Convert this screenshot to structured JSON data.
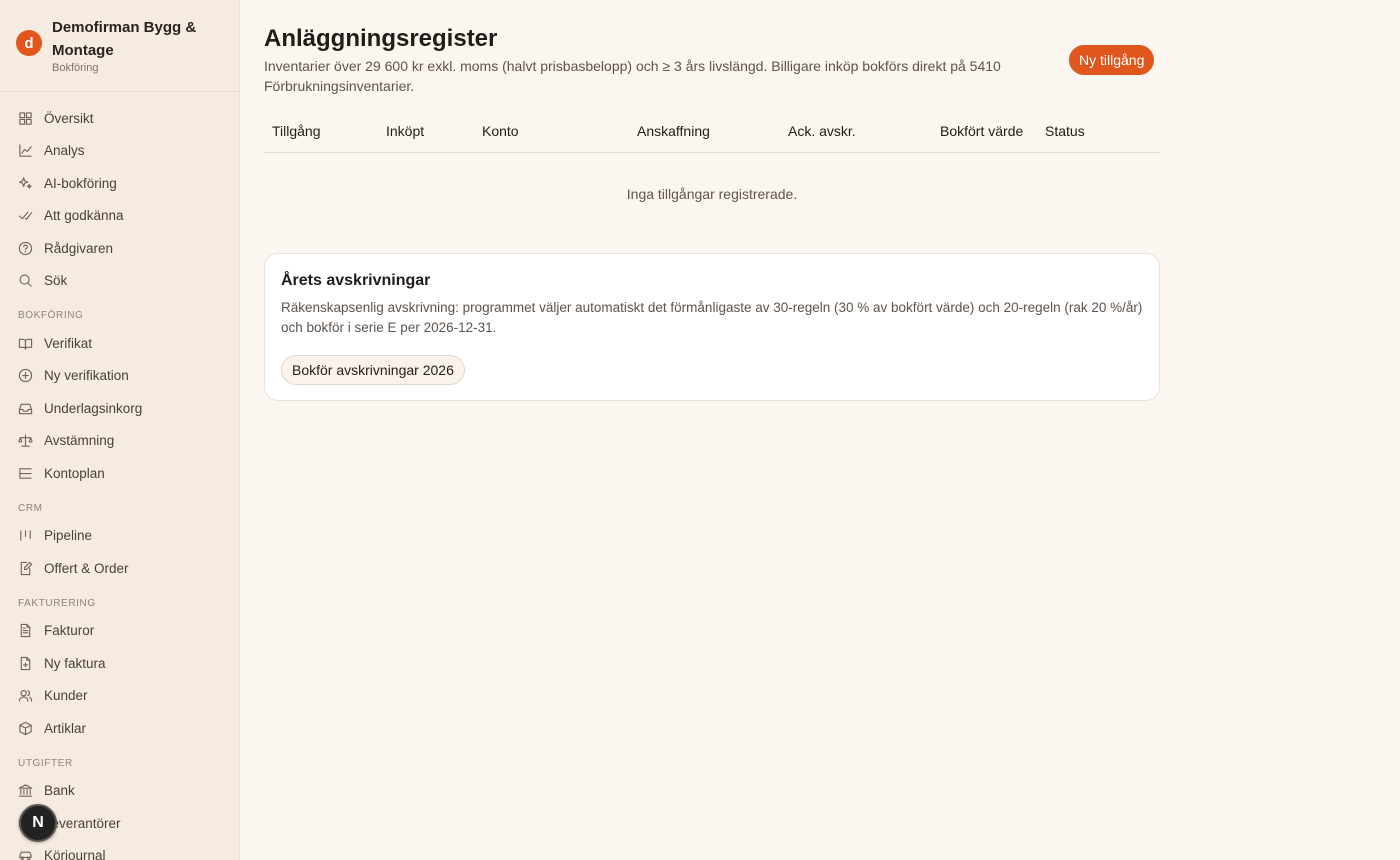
{
  "brand": {
    "logo_letter": "d",
    "name": "Demofirman Bygg & Montage",
    "subtitle": "Bokföring"
  },
  "nav": {
    "top": [
      {
        "label": "Översikt",
        "icon": "grid-icon"
      },
      {
        "label": "Analys",
        "icon": "chart-line-icon"
      },
      {
        "label": "AI-bokföring",
        "icon": "sparkles-icon"
      },
      {
        "label": "Att godkänna",
        "icon": "double-check-icon"
      },
      {
        "label": "Rådgivaren",
        "icon": "help-circle-icon"
      },
      {
        "label": "Sök",
        "icon": "search-icon"
      }
    ],
    "sections": [
      {
        "title": "BOKFÖRING",
        "items": [
          {
            "label": "Verifikat",
            "icon": "book-icon"
          },
          {
            "label": "Ny verifikation",
            "icon": "plus-circle-icon"
          },
          {
            "label": "Underlagsinkorg",
            "icon": "inbox-icon"
          },
          {
            "label": "Avstämning",
            "icon": "scale-icon"
          },
          {
            "label": "Kontoplan",
            "icon": "list-tree-icon"
          }
        ]
      },
      {
        "title": "CRM",
        "items": [
          {
            "label": "Pipeline",
            "icon": "kanban-icon"
          },
          {
            "label": "Offert & Order",
            "icon": "file-edit-icon"
          }
        ]
      },
      {
        "title": "FAKTURERING",
        "items": [
          {
            "label": "Fakturor",
            "icon": "file-text-icon"
          },
          {
            "label": "Ny faktura",
            "icon": "file-plus-icon"
          },
          {
            "label": "Kunder",
            "icon": "users-icon"
          },
          {
            "label": "Artiklar",
            "icon": "package-icon"
          }
        ]
      },
      {
        "title": "UTGIFTER",
        "items": [
          {
            "label": "Bank",
            "icon": "bank-icon"
          },
          {
            "label": "Leverantörer",
            "icon": "truck-icon"
          },
          {
            "label": "Körjournal",
            "icon": "car-icon"
          }
        ]
      }
    ]
  },
  "floating_badge": "N",
  "page": {
    "title": "Anläggningsregister",
    "description": "Inventarier över 29 600 kr exkl. moms (halvt prisbasbelopp) och ≥ 3 års livslängd. Billigare inköp bokförs direkt på 5410 Förbrukningsinventarier.",
    "new_asset_button": "Ny tillgång"
  },
  "table": {
    "columns": [
      "Tillgång",
      "Inköpt",
      "Konto",
      "Anskaffning",
      "Ack. avskr.",
      "Bokfört värde",
      "Status"
    ],
    "empty_text": "Inga tillgångar registrerade."
  },
  "depreciation_card": {
    "title": "Årets avskrivningar",
    "text": "Räkenskapsenlig avskrivning: programmet väljer automatiskt det förmånligaste av 30-regeln (30 % av bokfört värde) och 20-regeln (rak 20 %/år) och bokför i serie E per 2026-12-31.",
    "button": "Bokför avskrivningar 2026"
  },
  "colors": {
    "accent": "#e0561c",
    "sidebar_bg": "#f6ebe0",
    "page_bg": "#fcf6f0"
  }
}
